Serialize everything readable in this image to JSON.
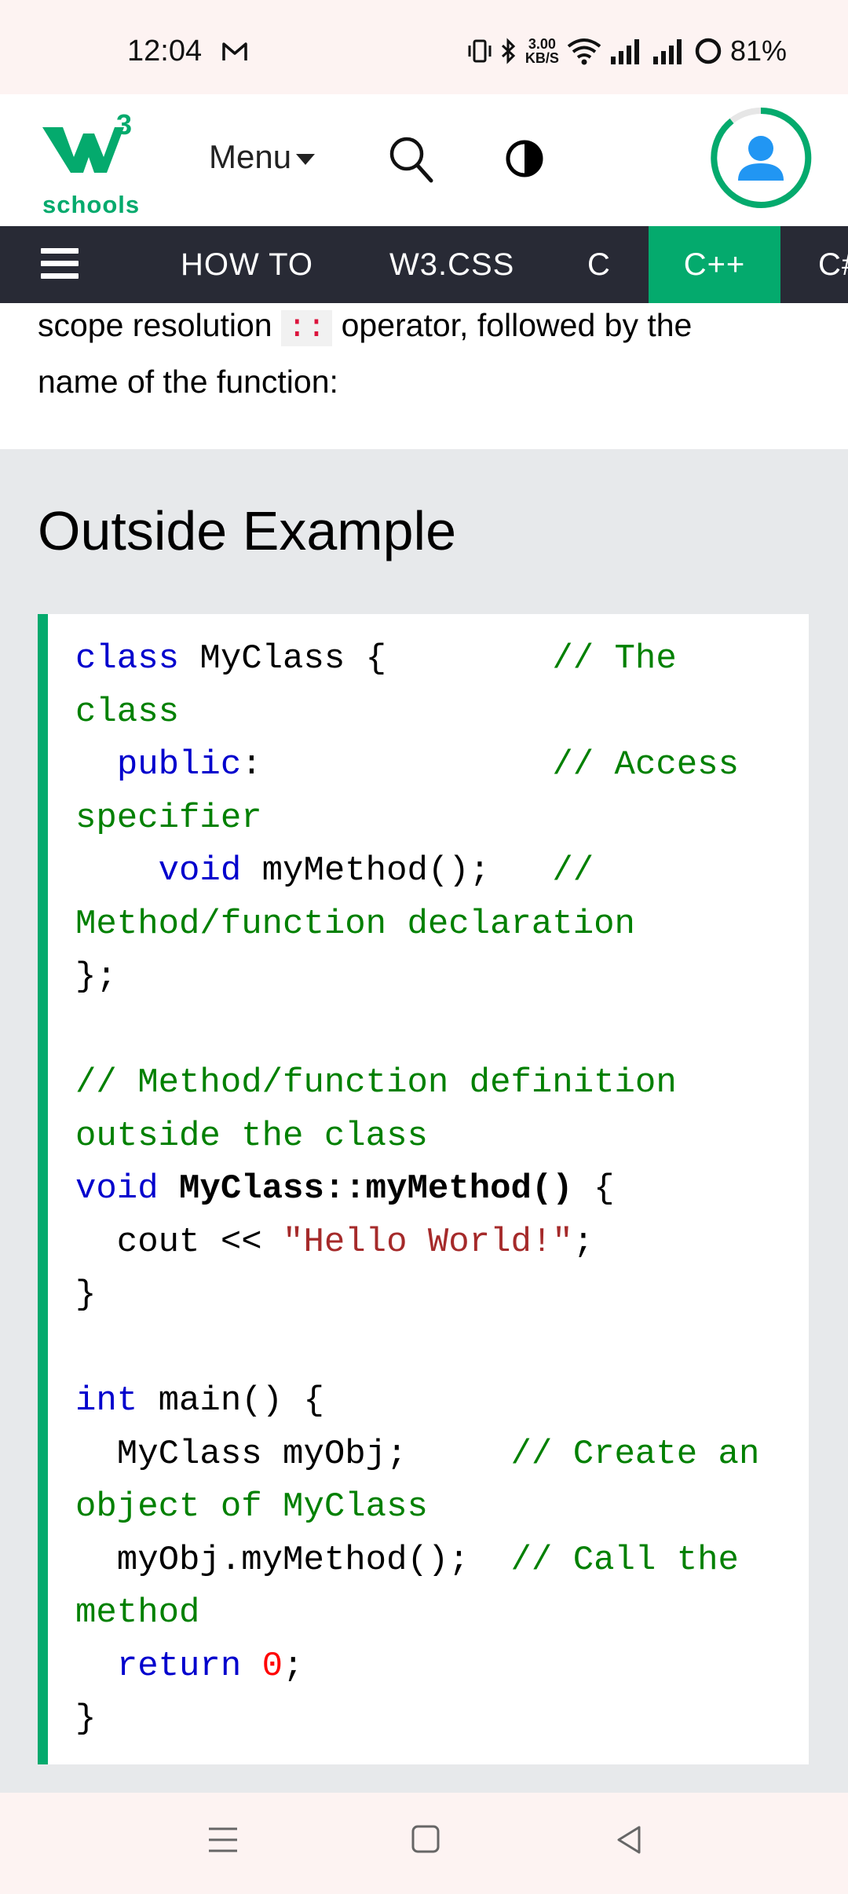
{
  "status_bar": {
    "time": "12:04",
    "speed_value": "3.00",
    "speed_unit": "KB/S",
    "battery": "81%",
    "icons": [
      "gmail-icon",
      "vibrate-icon",
      "bluetooth-icon",
      "wifi-icon",
      "signal-icon",
      "signal-icon",
      "battery-icon"
    ]
  },
  "header": {
    "logo_sup": "3",
    "logo_text": "schools",
    "menu_label": "Menu",
    "icons": [
      "search-icon",
      "contrast-icon",
      "user-avatar-icon"
    ]
  },
  "nav": {
    "items": [
      "HOW TO",
      "W3.CSS",
      "C",
      "C++",
      "C#"
    ],
    "active": "C++"
  },
  "content": {
    "intro_part1": "scope resolution",
    "intro_code": "::",
    "intro_part2": "operator, followed by the",
    "intro_line2": "name of the function:",
    "heading": "Outside Example"
  },
  "code_lines": [
    "class MyClass {        // The class",
    "  public:              // Access specifier",
    "    void myMethod();   // Method/function declaration",
    "};",
    "",
    "// Method/function definition outside the class",
    "void MyClass::myMethod() {",
    "  cout << \"Hello World!\";",
    "}",
    "",
    "int main() {",
    "  MyClass myObj;     // Create an object of MyClass",
    "  myObj.myMethod();  // Call the method",
    "  return 0;",
    "}"
  ],
  "colors": {
    "brand_green": "#04AA6D",
    "nav_dark": "#282a35",
    "keyword": "#0000cd",
    "comment": "#008000",
    "string": "#a52a2a",
    "number": "#ff0000"
  },
  "bottom_nav": {
    "icons": [
      "recent-apps-icon",
      "home-icon",
      "back-icon"
    ]
  }
}
